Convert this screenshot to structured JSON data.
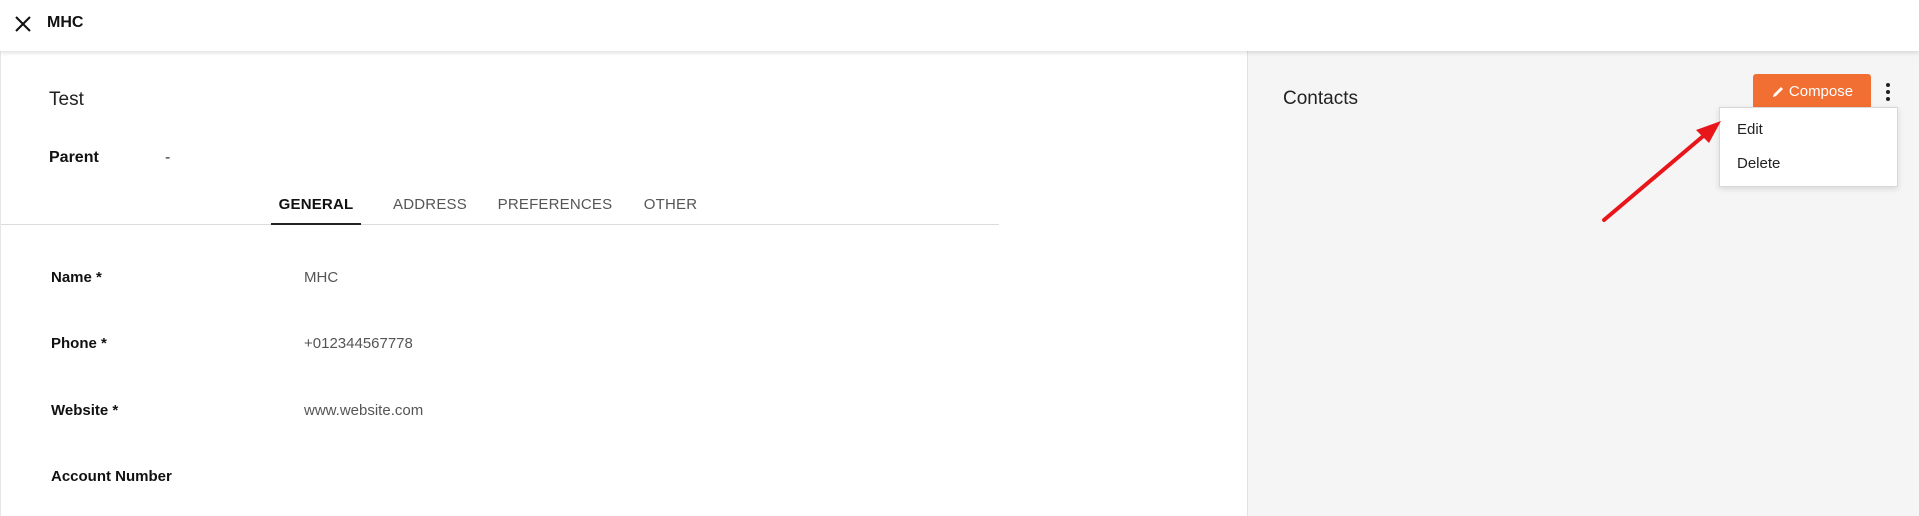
{
  "header": {
    "title": "MHC",
    "close_icon": "close-icon"
  },
  "record": {
    "title": "Test",
    "parent_label": "Parent",
    "parent_value": "-"
  },
  "tabs": [
    {
      "label": "GENERAL",
      "active": true
    },
    {
      "label": "ADDRESS",
      "active": false
    },
    {
      "label": "PREFERENCES",
      "active": false
    },
    {
      "label": "OTHER",
      "active": false
    }
  ],
  "fields": [
    {
      "label": "Name *",
      "value": "MHC"
    },
    {
      "label": "Phone *",
      "value": "+012344567778"
    },
    {
      "label": "Website *",
      "value": "www.website.com"
    },
    {
      "label": "Account Number",
      "value": ""
    }
  ],
  "contacts": {
    "title": "Contacts",
    "compose_label": "Compose",
    "compose_icon": "pencil-icon",
    "more_icon": "vertical-dots-icon"
  },
  "menu": {
    "items": [
      {
        "label": "Edit"
      },
      {
        "label": "Delete"
      }
    ]
  },
  "colors": {
    "accent": "#f26f33",
    "annotation_arrow": "#e8161b"
  }
}
